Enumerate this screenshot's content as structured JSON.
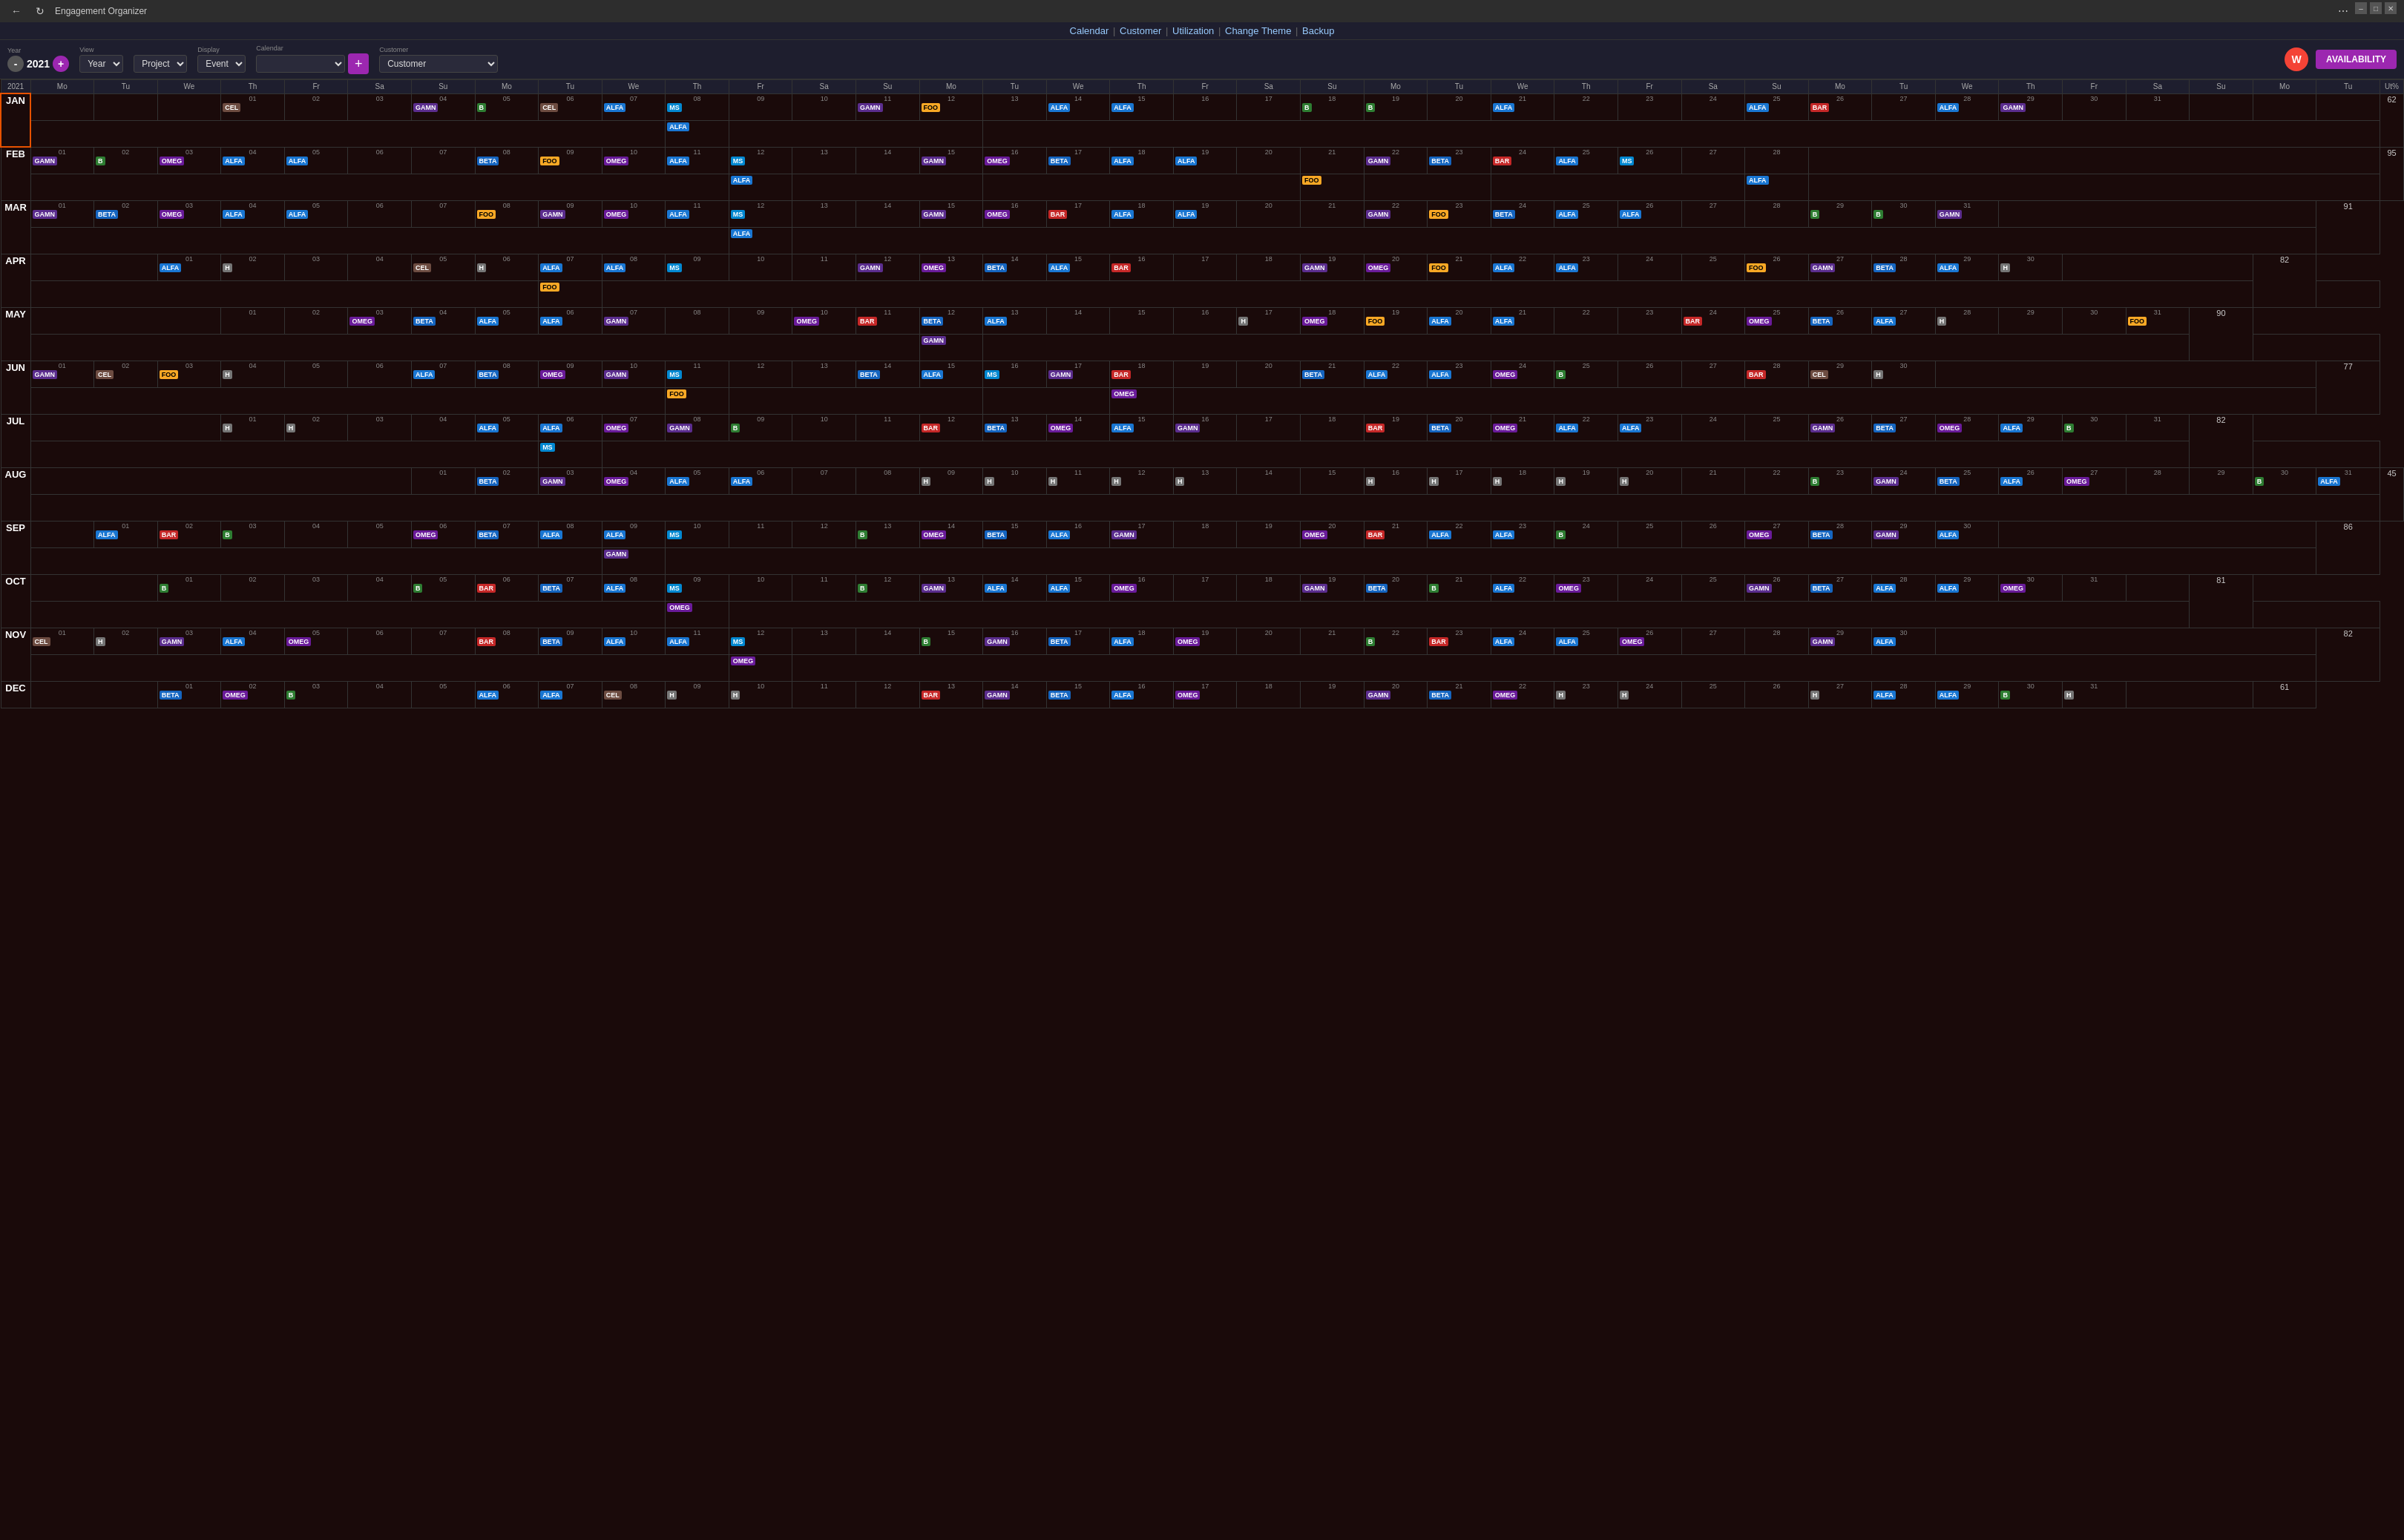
{
  "app": {
    "title": "Engagement Organizer"
  },
  "nav": {
    "items": [
      "Calendar",
      "Customer",
      "Utilization",
      "Change Theme",
      "Backup"
    ]
  },
  "toolbar": {
    "year_label": "Year",
    "year_value": "2021",
    "view_label": "View",
    "view_value": "Year",
    "project_label": "",
    "project_value": "Project",
    "display_label": "Display",
    "display_value": "Event",
    "calendar_label": "Calendar",
    "calendar_value": "",
    "customer_label": "Customer",
    "customer_value": "Customer",
    "minus_label": "-",
    "plus_label": "+",
    "availability_label": "AVAILABILITY",
    "user_initial": "W"
  },
  "calendar": {
    "header_year": "2021",
    "day_headers": [
      "Mo",
      "Tu",
      "We",
      "Th",
      "Fr",
      "Sa",
      "Su",
      "Mo",
      "Tu",
      "We",
      "Th",
      "Fr",
      "Sa",
      "Su",
      "Mo",
      "Tu",
      "We",
      "Th",
      "Fr",
      "Sa",
      "Su",
      "Mo",
      "Tu",
      "We",
      "Th",
      "Fr",
      "Sa",
      "Su",
      "Mo",
      "Tu",
      "We",
      "Th",
      "Fr",
      "Sa",
      "Su",
      "Mo",
      "Tu",
      "Ut%"
    ],
    "util_header": "Ut%",
    "months": [
      {
        "name": "JAN",
        "util": "62",
        "weeks": [
          {
            "days": [
              "",
              "",
              "",
              "01",
              "02",
              "03",
              "04",
              "05",
              "06",
              "07",
              "08",
              "09",
              "10",
              "11",
              "12",
              "13",
              "14",
              "15",
              "16",
              "17",
              "18",
              "19",
              "20",
              "21",
              "22",
              "23",
              "24",
              "25",
              "26",
              "27",
              "28",
              "29",
              "30",
              "31"
            ]
          },
          {
            "days": []
          }
        ]
      },
      {
        "name": "FEB",
        "util": "95"
      },
      {
        "name": "MAR",
        "util": "91"
      },
      {
        "name": "APR",
        "util": "82"
      },
      {
        "name": "MAY",
        "util": "90"
      },
      {
        "name": "JUN",
        "util": "77"
      },
      {
        "name": "JUL",
        "util": "82"
      },
      {
        "name": "AUG",
        "util": "45"
      },
      {
        "name": "SEP",
        "util": "86"
      },
      {
        "name": "OCT",
        "util": "81"
      },
      {
        "name": "NOV",
        "util": "82"
      },
      {
        "name": "DEC",
        "util": "61"
      }
    ]
  }
}
